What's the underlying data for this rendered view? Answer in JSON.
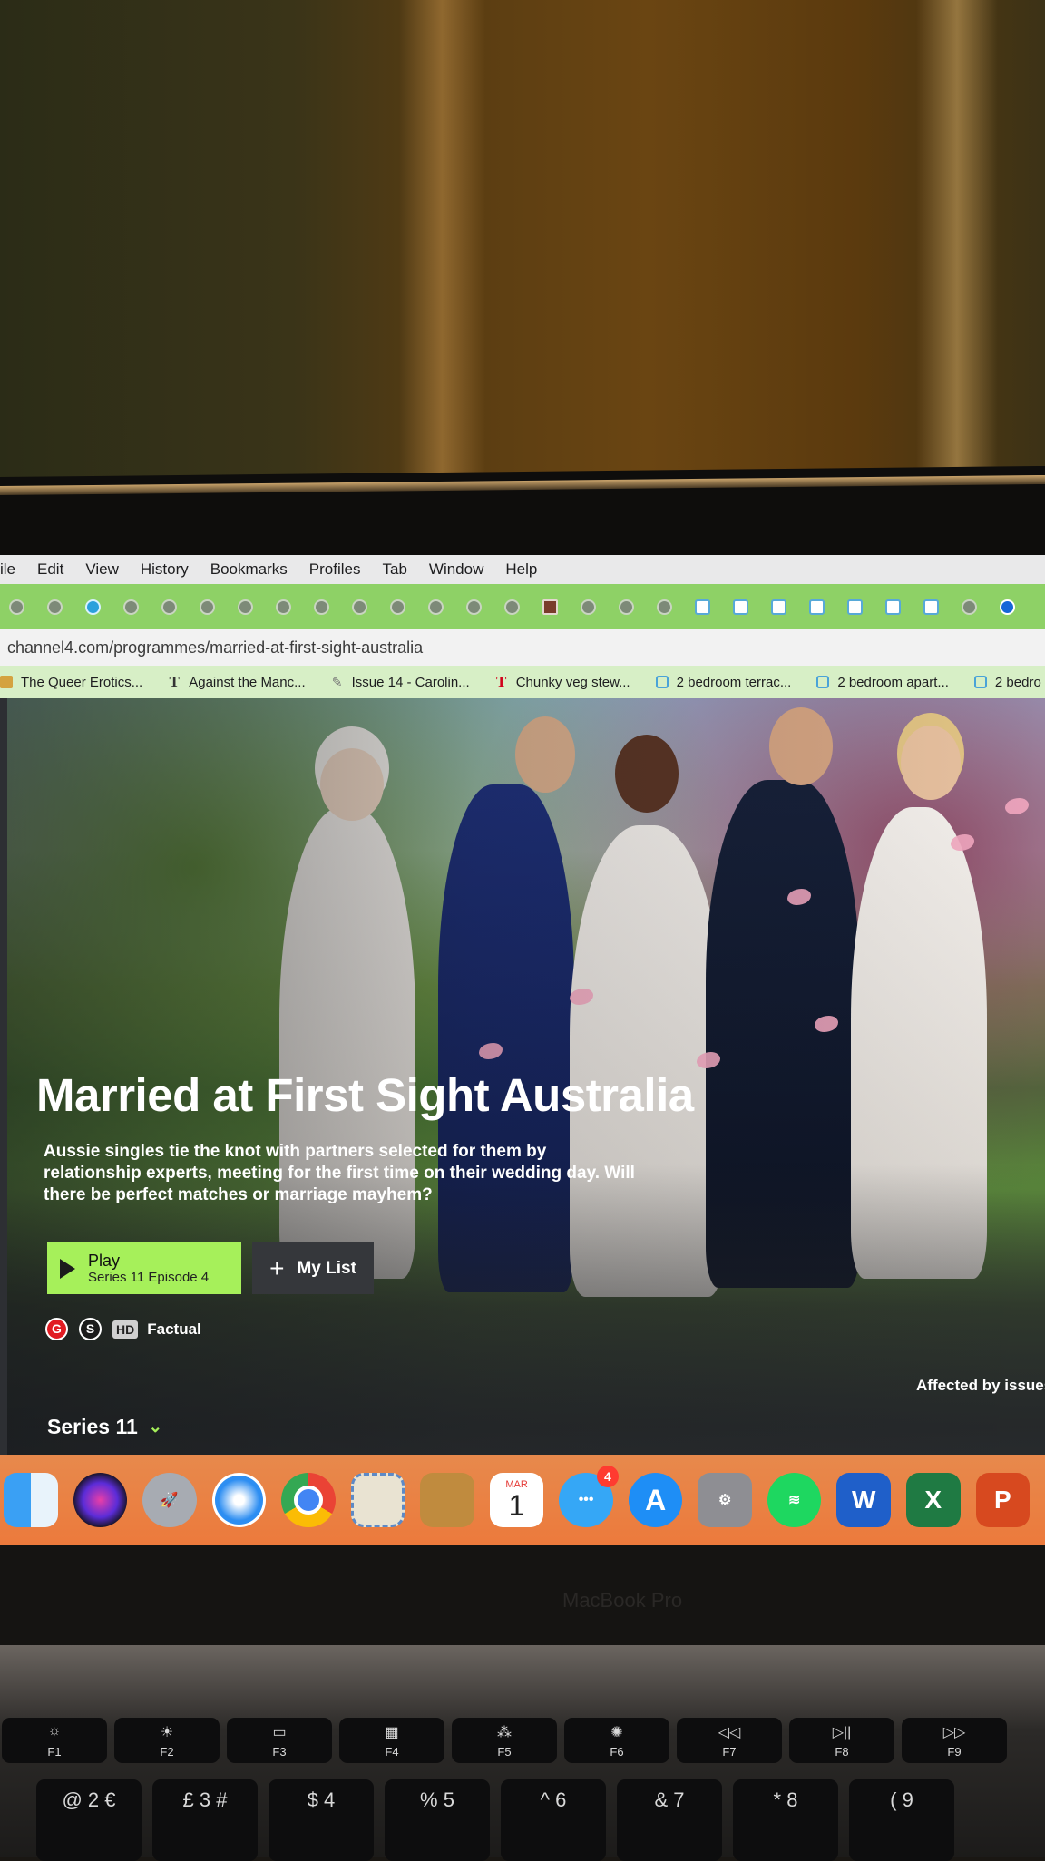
{
  "menubar": {
    "items": [
      "ile",
      "Edit",
      "View",
      "History",
      "Bookmarks",
      "Profiles",
      "Tab",
      "Window",
      "Help"
    ]
  },
  "address": {
    "url": "channel4.com/programmes/married-at-first-sight-australia"
  },
  "bookmarks": [
    {
      "label": "The Queer Erotics...",
      "icon": "queer-erotics-favicon"
    },
    {
      "label": "Against the Manc...",
      "icon": "t-favicon"
    },
    {
      "label": "Issue 14 - Carolin...",
      "icon": "quill-favicon"
    },
    {
      "label": "Chunky veg stew...",
      "icon": "t-red-favicon"
    },
    {
      "label": "2 bedroom terrac...",
      "icon": "house-favicon"
    },
    {
      "label": "2 bedroom apart...",
      "icon": "house-favicon"
    },
    {
      "label": "2 bedro",
      "icon": "house-favicon"
    }
  ],
  "hero": {
    "title": "Married at First Sight Australia",
    "description": "Aussie singles tie the knot with partners selected for them by relationship experts, meeting for the first time on their wedding day. Will there be perfect matches or marriage mayhem?",
    "play_label": "Play",
    "play_sub": "Series 11 Episode 4",
    "mylist_label": "My List",
    "badge_g": "G",
    "badge_s": "S",
    "badge_hd": "HD",
    "genre": "Factual",
    "affected": "Affected by issues",
    "series_label": "Series 11"
  },
  "dock": {
    "items": [
      "finder-icon",
      "siri-icon",
      "launchpad-icon",
      "safari-icon",
      "chrome-icon",
      "mail-icon",
      "contacts-icon",
      "calendar-icon",
      "messages-icon",
      "app-store-icon",
      "system-settings-icon",
      "spotify-icon",
      "word-icon",
      "excel-icon",
      "powerpoint-icon"
    ],
    "calendar_month": "MAR",
    "calendar_day": "1",
    "messages_badge": "4",
    "word_letter": "W",
    "excel_letter": "X",
    "ppt_letter": "P"
  },
  "device": {
    "model": "MacBook Pro"
  },
  "keyboard": {
    "fkeys": [
      "F1",
      "F2",
      "F3",
      "F4",
      "F5",
      "F6",
      "F7",
      "F8",
      "F9"
    ],
    "numkeys": [
      "@ 2 €",
      "£ 3 #",
      "$ 4",
      "% 5",
      "^ 6",
      "& 7",
      "* 8",
      "( 9"
    ]
  },
  "colors": {
    "tab_bar": "#8ed166",
    "play_button": "#a6f05a",
    "dock": "#ec7a3c",
    "badge_g": "#e11b22"
  }
}
